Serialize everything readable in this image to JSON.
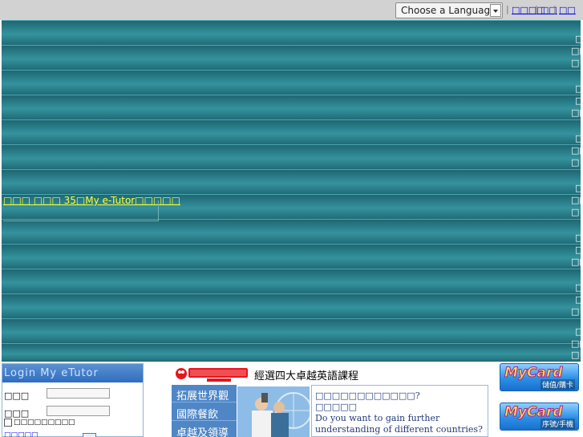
{
  "topbar": {
    "language_select": "Choose a Language",
    "links": [
      "□□□□",
      "□□",
      "□□"
    ],
    "separator": "|"
  },
  "banner": {
    "marquee": "□□□ □□□ 35□My e-Tutor□□□□□",
    "glyph": "□",
    "glyph_pair": "□□"
  },
  "login": {
    "title": "Login My eTutor",
    "account_label": "□□□",
    "password_label": "□□□",
    "remember_label": "□□□□□□□□□",
    "forgot_link": "□□□□□"
  },
  "promo": {
    "heading": "經選四大卓越英語課程",
    "menu": [
      "拓展世界觀",
      "國際餐飲",
      "卓越及領導"
    ],
    "text_lines": [
      "□□□□□□□□□□□□?",
      "□□□□□",
      "Do you want to gain further",
      "understanding of different countries?"
    ]
  },
  "ads": {
    "mycard_logo": "MyCard",
    "mycard1_caption": "儲值/購卡",
    "mycard2_caption": "序號/手機"
  },
  "colors": {
    "banner_teal": "#2f8b96",
    "marquee_yellow": "#ffff33",
    "login_header_blue": "#2f6dbf",
    "link_blue": "#0000ee"
  }
}
